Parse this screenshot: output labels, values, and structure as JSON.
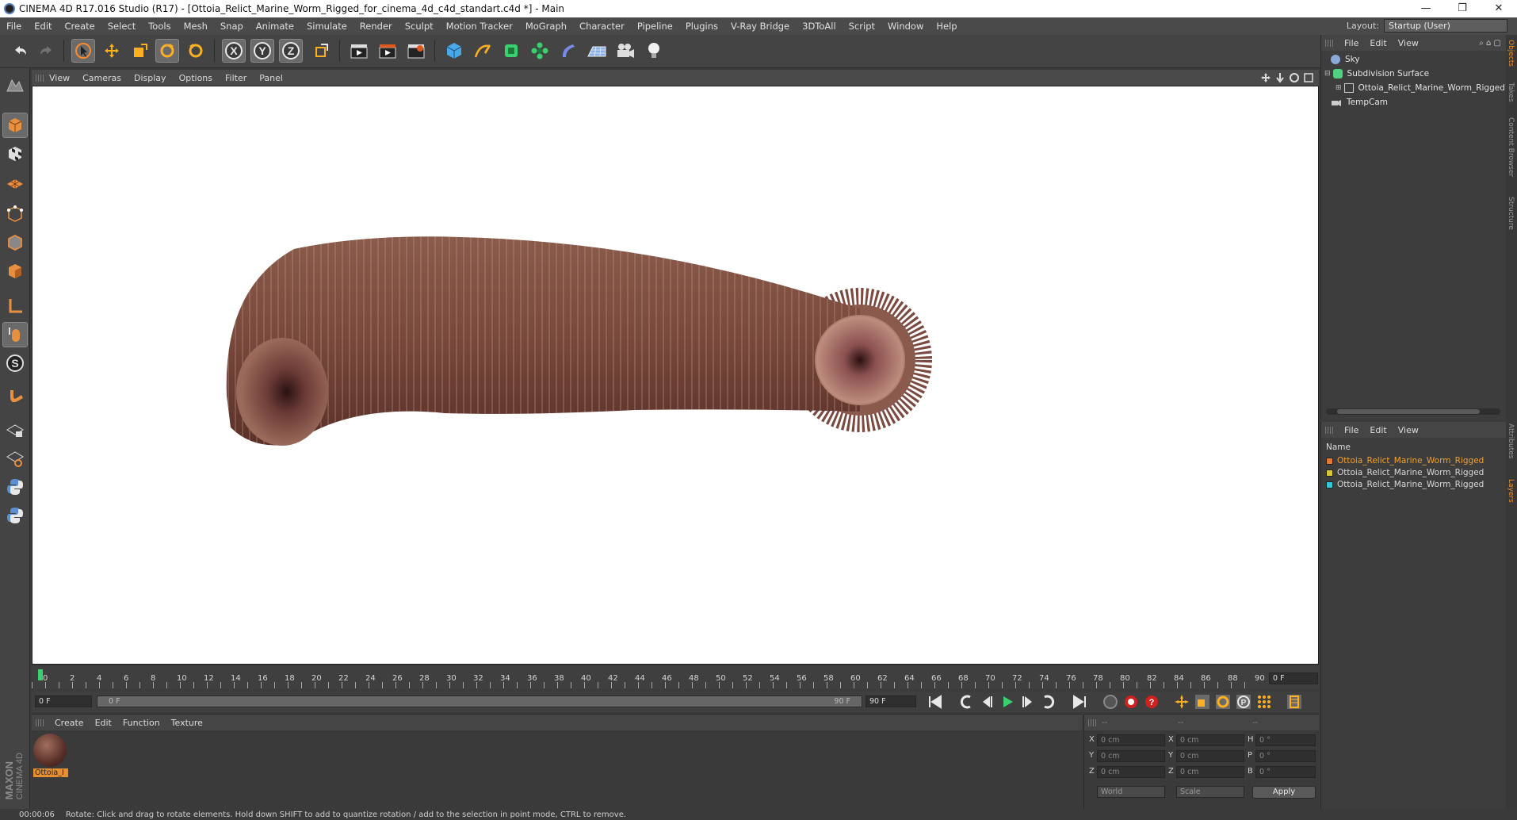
{
  "window": {
    "title": "CINEMA 4D R17.016 Studio (R17) - [Ottoia_Relict_Marine_Worm_Rigged_for_cinema_4d_c4d_standart.c4d *] - Main",
    "minimize": "—",
    "restore": "❐",
    "close": "✕"
  },
  "menubar": {
    "items": [
      "File",
      "Edit",
      "Create",
      "Select",
      "Tools",
      "Mesh",
      "Snap",
      "Animate",
      "Simulate",
      "Render",
      "Sculpt",
      "Motion Tracker",
      "MoGraph",
      "Character",
      "Pipeline",
      "Plugins",
      "V-Ray Bridge",
      "3DToAll",
      "Script",
      "Window",
      "Help"
    ],
    "layout_label": "Layout:",
    "layout_value": "Startup (User)"
  },
  "viewport": {
    "menu": [
      "View",
      "Cameras",
      "Display",
      "Options",
      "Filter",
      "Panel"
    ]
  },
  "timeline": {
    "ticks": [
      "0",
      "2",
      "4",
      "6",
      "8",
      "10",
      "12",
      "14",
      "16",
      "18",
      "20",
      "22",
      "24",
      "26",
      "28",
      "30",
      "32",
      "34",
      "36",
      "38",
      "40",
      "42",
      "44",
      "46",
      "48",
      "50",
      "52",
      "54",
      "56",
      "58",
      "60",
      "62",
      "64",
      "66",
      "68",
      "70",
      "72",
      "74",
      "76",
      "78",
      "80",
      "82",
      "84",
      "86",
      "88",
      "90"
    ],
    "current_frame": "0 F",
    "start_field": "0 F",
    "range_start": "0 F",
    "range_end": "90 F",
    "end_field": "90 F"
  },
  "material_manager": {
    "menu": [
      "Create",
      "Edit",
      "Function",
      "Texture"
    ],
    "material_name": "Ottoia_I"
  },
  "coordinates": {
    "header": [
      "--",
      "--",
      "--"
    ],
    "rows": [
      {
        "a": "X",
        "av": "0 cm",
        "b": "X",
        "bv": "0 cm",
        "c": "H",
        "cv": "0 °"
      },
      {
        "a": "Y",
        "av": "0 cm",
        "b": "Y",
        "bv": "0 cm",
        "c": "P",
        "cv": "0 °"
      },
      {
        "a": "Z",
        "av": "0 cm",
        "b": "Z",
        "bv": "0 cm",
        "c": "B",
        "cv": "0 °"
      }
    ],
    "mode1": "World",
    "mode2": "Scale",
    "apply": "Apply"
  },
  "object_manager": {
    "menu": [
      "File",
      "Edit",
      "View"
    ],
    "objects": [
      {
        "name": "Sky",
        "color": "#8aa8d8"
      },
      {
        "name": "Subdivision Surface",
        "color": "#4fcf7f"
      },
      {
        "name": "Ottoia_Relict_Marine_Worm_Rigged",
        "color": "#cccccc"
      },
      {
        "name": "TempCam",
        "color": "#cccccc"
      }
    ]
  },
  "layer_manager": {
    "menu": [
      "File",
      "Edit",
      "View"
    ],
    "column": "Name",
    "layers": [
      {
        "name": "Ottoia_Relict_Marine_Worm_Rigged",
        "color": "#e07a30",
        "text": "#f0a030"
      },
      {
        "name": "Ottoia_Relict_Marine_Worm_Rigged",
        "color": "#d8c830",
        "text": "#d8d8d8"
      },
      {
        "name": "Ottoia_Relict_Marine_Worm_Rigged",
        "color": "#30c8d8",
        "text": "#d8d8d8"
      }
    ]
  },
  "side_tabs": {
    "top": [
      "Objects",
      "Takes",
      "Content Browser",
      "Structure"
    ],
    "bottom": [
      "Attributes",
      "Layers"
    ]
  },
  "brand": {
    "line1": "MAXON",
    "line2": "CINEMA 4D"
  },
  "status": {
    "time": "00:00:06",
    "message": "Rotate: Click and drag to rotate elements. Hold down SHIFT to add to quantize rotation / add to the selection in point mode, CTRL to remove."
  }
}
